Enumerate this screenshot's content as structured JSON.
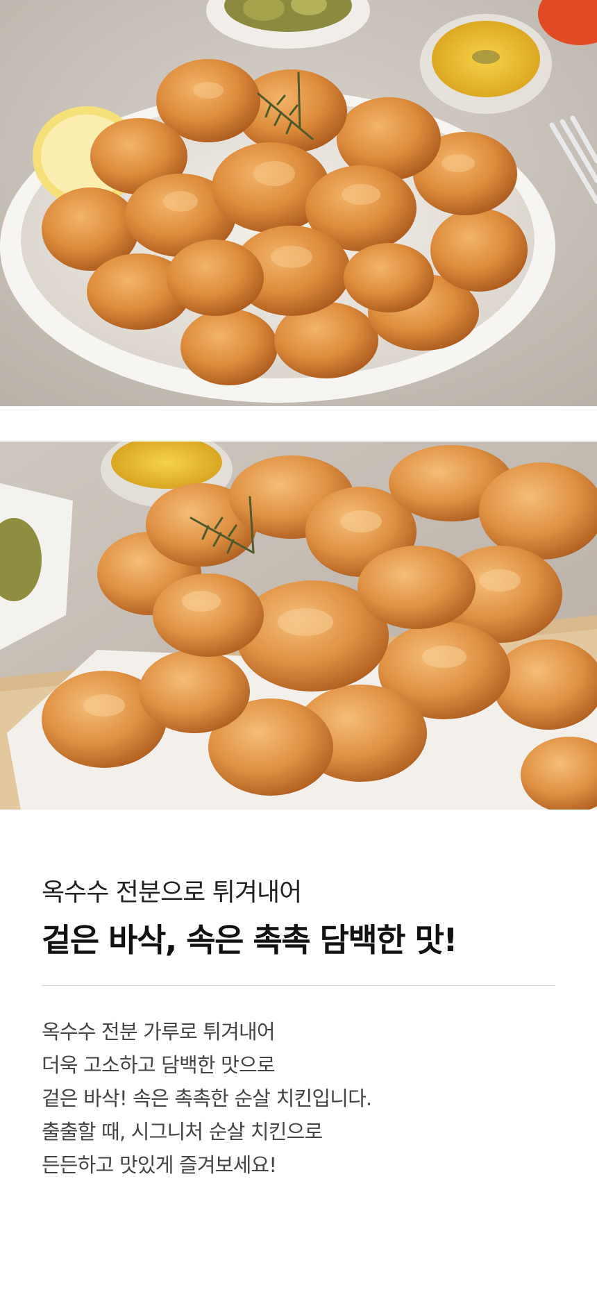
{
  "images": [
    {
      "name": "fried-chicken-bowl-photo"
    },
    {
      "name": "fried-chicken-board-photo"
    }
  ],
  "content": {
    "subhead": "옥수수 전분으로 튀겨내어",
    "headline": "겉은 바삭, 속은 촉촉 담백한 맛!",
    "body_lines": [
      "옥수수 전분 가루로 튀겨내어",
      "더욱 고소하고 담백한 맛으로",
      "겉은 바삭! 속은 촉촉한 순살 치킨입니다.",
      "출출할 때, 시그니처 순살 치킨으로",
      "든든하고 맛있게 즐겨보세요!"
    ]
  },
  "colors": {
    "background": "#ffffff",
    "text_primary": "#111111",
    "text_body": "#444444",
    "divider": "#d9d9d9",
    "chicken_crust": "#d9883a"
  }
}
